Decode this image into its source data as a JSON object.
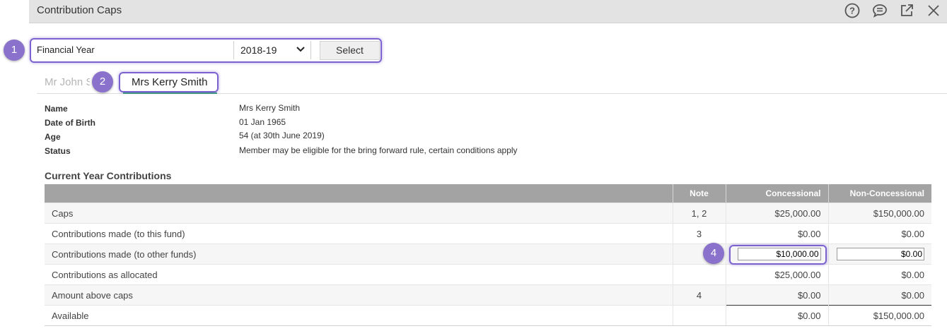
{
  "window": {
    "title": "Contribution Caps",
    "icons": [
      "help-icon",
      "comment-icon",
      "external-link-icon",
      "close-icon"
    ]
  },
  "financial_year": {
    "label": "Financial Year",
    "selected": "2018-19",
    "select_button": "Select"
  },
  "tabs": [
    {
      "label": "Mr John S"
    },
    {
      "label": "Mrs Kerry Smith",
      "active": true
    }
  ],
  "member": {
    "name_label": "Name",
    "name": "Mrs Kerry Smith",
    "dob_label": "Date of Birth",
    "dob": "01 Jan 1965",
    "age_label": "Age",
    "age": "54 (at 30th June 2019)",
    "status_label": "Status",
    "status": "Member may be eligible for the bring forward rule, certain conditions apply"
  },
  "contributions": {
    "title": "Current Year Contributions",
    "columns": [
      "",
      "Note",
      "Concessional",
      "Non-Concessional"
    ],
    "rows": [
      {
        "label": "Caps",
        "note": "1, 2",
        "concessional": "$25,000.00",
        "non_concessional": "$150,000.00"
      },
      {
        "label": "Contributions made (to this fund)",
        "note": "3",
        "concessional": "$0.00",
        "non_concessional": "$0.00"
      },
      {
        "label": "Contributions made (to other funds)",
        "note": "",
        "concessional": "$10,000.00",
        "non_concessional": "$0.00"
      },
      {
        "label": "Contributions as allocated",
        "note": "",
        "concessional": "$25,000.00",
        "non_concessional": "$0.00"
      },
      {
        "label": "Amount above caps",
        "note": "4",
        "concessional": "$0.00",
        "non_concessional": "$0.00"
      },
      {
        "label": "Available",
        "note": "",
        "concessional": "$0.00",
        "non_concessional": "$150,000.00"
      }
    ]
  },
  "callouts": [
    "1",
    "2",
    "4"
  ],
  "colors": {
    "accent": "#7b62cf",
    "marker": "#8a72cc",
    "header_bg": "#a3a3a3",
    "tab_underline": "#2f9e6e"
  }
}
